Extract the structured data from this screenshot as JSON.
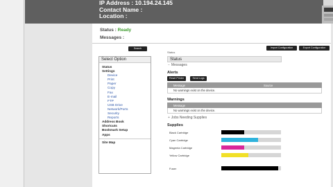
{
  "header": {
    "ip_address": "IP Address : 10.194.24.145",
    "contact_name": "Contact Name :",
    "location": "Location :"
  },
  "status": {
    "label": "Status :",
    "value": "Ready"
  },
  "messages_label": "Messages :",
  "buttons": {
    "search": "Search",
    "import": "Import Configuration",
    "export": "Export Configuration"
  },
  "breadcrumb": "Status",
  "sidebar": {
    "heading": "Select Option",
    "items": [
      {
        "label": "Status",
        "level": 1
      },
      {
        "label": "Settings",
        "level": 1
      },
      {
        "label": "Device",
        "level": 2
      },
      {
        "label": "Print",
        "level": 2
      },
      {
        "label": "Paper",
        "level": 2
      },
      {
        "label": "Copy",
        "level": 2
      },
      {
        "label": "Fax",
        "level": 2
      },
      {
        "label": "E-mail",
        "level": 2
      },
      {
        "label": "FTP",
        "level": 2
      },
      {
        "label": "USB Drive",
        "level": 2
      },
      {
        "label": "Network/Ports",
        "level": 2
      },
      {
        "label": "Security",
        "level": 2
      },
      {
        "label": "Reports",
        "level": 2
      },
      {
        "label": "Address Book",
        "level": 1
      },
      {
        "label": "Shortcuts",
        "level": 1
      },
      {
        "label": "Bookmark Setup",
        "level": 1
      },
      {
        "label": "Apps",
        "level": 1
      }
    ],
    "site_map": "Site Map"
  },
  "main": {
    "status_heading": "Status",
    "messages_toggle": "Messages",
    "alerts": {
      "title": "Alerts",
      "reset_button": "Reset Printer",
      "send_button": "Send Logs",
      "columns": [
        "Message",
        "Source"
      ],
      "empty_text": "No warnings exist on the device."
    },
    "warnings": {
      "title": "Warnings",
      "columns": [
        "Message"
      ],
      "empty_text": "No warnings exist on the device."
    },
    "supplies_toggle": "Jobs Needing Supplies",
    "supplies_title": "Supplies",
    "supplies": [
      {
        "name": "Black Cartridge",
        "level": 0.38,
        "color": "#000000"
      },
      {
        "name": "Cyan Cartridge",
        "level": 0.62,
        "color": "#2fb3dc"
      },
      {
        "name": "Magenta Cartridge",
        "level": 0.38,
        "color": "#d8279a"
      },
      {
        "name": "Yellow Cartridge",
        "level": 0.45,
        "color": "#f1e027"
      },
      {
        "name": "Fuser",
        "level": 0.95,
        "color": "#000000"
      }
    ]
  }
}
